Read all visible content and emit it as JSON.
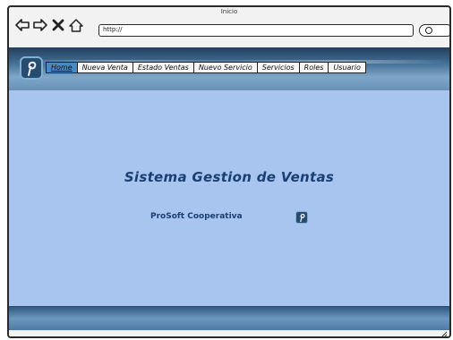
{
  "window": {
    "title": "Inicio",
    "url": "http://"
  },
  "toolbar": {
    "back_icon": "back-arrow-icon",
    "forward_icon": "forward-arrow-icon",
    "stop_icon": "close-icon",
    "home_icon": "home-icon",
    "search_icon": "search-icon"
  },
  "menu": {
    "items": [
      {
        "label": "Home"
      },
      {
        "label": "Nueva Venta"
      },
      {
        "label": "Estado Ventas"
      },
      {
        "label": "Nuevo Servicio"
      },
      {
        "label": "Servicios"
      },
      {
        "label": "Roles"
      },
      {
        "label": "Usuario"
      }
    ]
  },
  "main": {
    "title": "Sistema Gestion de Ventas",
    "subtitle": "ProSoft Cooperativa"
  },
  "colors": {
    "content_bg": "#a7c5ee",
    "text_dark_blue": "#1b3f73",
    "active_tab": "#4a87c3"
  }
}
